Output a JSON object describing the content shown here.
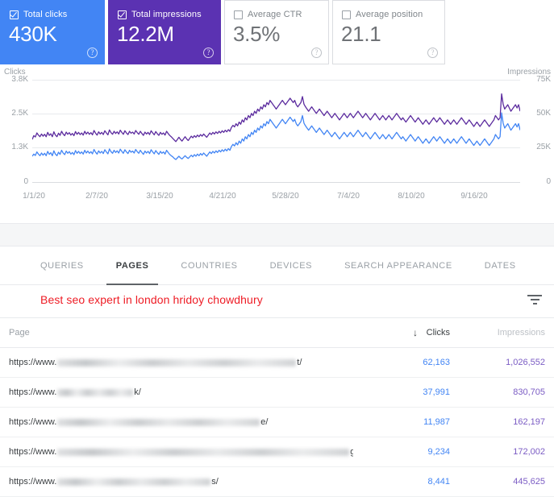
{
  "metric_cards": [
    {
      "label": "Total clicks",
      "value": "430K",
      "checked": true,
      "color": "#4285f4",
      "help": "?"
    },
    {
      "label": "Total impressions",
      "value": "12.2M",
      "checked": true,
      "color": "#5b32b2",
      "help": "?"
    },
    {
      "label": "Average CTR",
      "value": "3.5%",
      "checked": false,
      "color": "#ffffff",
      "help": "?"
    },
    {
      "label": "Average position",
      "value": "21.1",
      "checked": false,
      "color": "#ffffff",
      "help": "?"
    }
  ],
  "chart_data": {
    "type": "line",
    "title": "",
    "left_axis_label": "Clicks",
    "right_axis_label": "Impressions",
    "left_ticks": [
      "3.8K",
      "2.5K",
      "1.3K",
      "0"
    ],
    "right_ticks": [
      "75K",
      "50K",
      "25K",
      "0"
    ],
    "left_ylim": [
      0,
      3800
    ],
    "right_ylim": [
      0,
      75000
    ],
    "grid": true,
    "legend_position": "none",
    "x_tick_labels": [
      "1/1/20",
      "2/7/20",
      "3/15/20",
      "4/21/20",
      "5/28/20",
      "7/4/20",
      "8/10/20",
      "9/16/20"
    ],
    "series": [
      {
        "name": "Total impressions",
        "color": "#5b2b9e",
        "axis": "right",
        "values": [
          1600,
          1740,
          1690,
          1840,
          1760,
          1700,
          1800,
          1720,
          1790,
          1700,
          1860,
          1750,
          1810,
          1700,
          1880,
          1760,
          1700,
          1830,
          1750,
          1900,
          1800,
          1740,
          1870,
          1790,
          1850,
          1760,
          1820,
          1740,
          1890,
          1790,
          1860,
          1780,
          1840,
          1760,
          1900,
          1800,
          1870,
          1790,
          1850,
          1770,
          1930,
          1830,
          1760,
          1880,
          1800,
          1860,
          1780,
          1920,
          1840,
          1770,
          1950,
          1850,
          1790,
          1900,
          1820,
          1880,
          1800,
          1940,
          1860,
          1790,
          1920,
          1840,
          1780,
          1900,
          1830,
          1870,
          1800,
          1930,
          1850,
          1790,
          1900,
          1820,
          1750,
          1870,
          1800,
          1860,
          1780,
          1920,
          1840,
          1770,
          1890,
          1810,
          1750,
          1860,
          1790,
          1840,
          1760,
          1900,
          1820,
          1750,
          1700,
          1640,
          1580,
          1520,
          1600,
          1680,
          1600,
          1540,
          1620,
          1700,
          1620,
          1560,
          1640,
          1720,
          1660,
          1740,
          1680,
          1760,
          1700,
          1780,
          1720,
          1800,
          1740,
          1680,
          1760,
          1840,
          1780,
          1860,
          1800,
          1880,
          1820,
          1900,
          1840,
          1920,
          1860,
          1940,
          1880,
          1960,
          1900,
          2040,
          2120,
          2060,
          2180,
          2100,
          2240,
          2160,
          2320,
          2240,
          2400,
          2320,
          2480,
          2400,
          2560,
          2480,
          2640,
          2560,
          2720,
          2640,
          2800,
          2720,
          2880,
          2800,
          2960,
          2880,
          3040,
          2960,
          2880,
          2800,
          2720,
          2800,
          2880,
          2960,
          3040,
          2960,
          2880,
          2960,
          3040,
          3120,
          3040,
          2960,
          3040,
          2880,
          2800,
          2880,
          2960,
          3180,
          2900,
          2800,
          2720,
          2640,
          2720,
          2800,
          2720,
          2640,
          2560,
          2640,
          2720,
          2640,
          2560,
          2480,
          2560,
          2640,
          2560,
          2480,
          2400,
          2480,
          2560,
          2480,
          2400,
          2320,
          2400,
          2480,
          2560,
          2480,
          2400,
          2480,
          2560,
          2480,
          2400,
          2480,
          2560,
          2640,
          2560,
          2480,
          2400,
          2480,
          2560,
          2480,
          2400,
          2320,
          2400,
          2480,
          2560,
          2480,
          2400,
          2320,
          2400,
          2480,
          2400,
          2320,
          2400,
          2480,
          2400,
          2320,
          2400,
          2480,
          2560,
          2480,
          2400,
          2320,
          2400,
          2320,
          2240,
          2320,
          2400,
          2480,
          2400,
          2320,
          2240,
          2320,
          2400,
          2320,
          2240,
          2160,
          2240,
          2320,
          2240,
          2160,
          2240,
          2320,
          2400,
          2320,
          2240,
          2320,
          2400,
          2320,
          2240,
          2160,
          2240,
          2320,
          2240,
          2160,
          2240,
          2320,
          2240,
          2160,
          2240,
          2320,
          2400,
          2320,
          2240,
          2160,
          2240,
          2320,
          2240,
          2160,
          2080,
          2160,
          2240,
          2160,
          2080,
          2160,
          2240,
          2320,
          2240,
          2160,
          2080,
          2160,
          2240,
          2320,
          2480,
          2400,
          2320,
          2400,
          3280,
          2900,
          2720,
          2800,
          2880,
          2760,
          2640,
          2720,
          2800,
          2880,
          2760,
          2880,
          2640
        ]
      },
      {
        "name": "Total clicks",
        "color": "#4285f4",
        "axis": "left",
        "values": [
          980,
          1060,
          1010,
          1140,
          1060,
          1000,
          1100,
          1020,
          1090,
          1000,
          1160,
          1050,
          1110,
          1000,
          1180,
          1060,
          1000,
          1130,
          1050,
          1200,
          1100,
          1040,
          1170,
          1090,
          1150,
          1060,
          1120,
          1040,
          1190,
          1090,
          1160,
          1080,
          1140,
          1060,
          1200,
          1100,
          1170,
          1090,
          1150,
          1070,
          1230,
          1130,
          1060,
          1180,
          1100,
          1160,
          1080,
          1220,
          1140,
          1070,
          1250,
          1150,
          1090,
          1200,
          1120,
          1180,
          1100,
          1240,
          1160,
          1090,
          1220,
          1140,
          1080,
          1200,
          1130,
          1170,
          1100,
          1230,
          1150,
          1090,
          1200,
          1120,
          1050,
          1170,
          1100,
          1160,
          1080,
          1220,
          1140,
          1070,
          1190,
          1110,
          1050,
          1160,
          1090,
          1140,
          1060,
          1200,
          1120,
          1050,
          1000,
          960,
          900,
          860,
          920,
          980,
          920,
          880,
          940,
          1000,
          940,
          900,
          960,
          1020,
          960,
          1040,
          980,
          1060,
          1000,
          1080,
          1020,
          1100,
          1040,
          980,
          1060,
          1140,
          1080,
          1160,
          1100,
          1180,
          1120,
          1200,
          1140,
          1220,
          1160,
          1240,
          1180,
          1260,
          1200,
          1340,
          1420,
          1360,
          1480,
          1400,
          1540,
          1460,
          1620,
          1540,
          1700,
          1620,
          1780,
          1700,
          1860,
          1780,
          1940,
          1860,
          2020,
          1940,
          2100,
          2020,
          2180,
          2100,
          2260,
          2180,
          2340,
          2260,
          2180,
          2100,
          2020,
          2100,
          2180,
          2260,
          2340,
          2260,
          2180,
          2260,
          2340,
          2420,
          2340,
          2260,
          2340,
          2180,
          2100,
          2180,
          2260,
          2480,
          2200,
          2100,
          2020,
          1940,
          2020,
          2100,
          2020,
          1940,
          1860,
          1940,
          2020,
          1940,
          1860,
          1780,
          1860,
          1940,
          1860,
          1780,
          1700,
          1780,
          1860,
          1780,
          1700,
          1620,
          1700,
          1780,
          1860,
          1780,
          1700,
          1780,
          1860,
          1780,
          1700,
          1780,
          1860,
          1940,
          1860,
          1780,
          1700,
          1780,
          1860,
          1780,
          1700,
          1620,
          1700,
          1780,
          1860,
          1780,
          1700,
          1620,
          1700,
          1780,
          1700,
          1620,
          1700,
          1780,
          1700,
          1620,
          1700,
          1780,
          1860,
          1780,
          1700,
          1620,
          1700,
          1620,
          1540,
          1620,
          1700,
          1780,
          1700,
          1620,
          1540,
          1620,
          1700,
          1620,
          1540,
          1460,
          1540,
          1620,
          1540,
          1460,
          1540,
          1620,
          1700,
          1620,
          1540,
          1620,
          1700,
          1620,
          1540,
          1460,
          1540,
          1620,
          1540,
          1460,
          1540,
          1620,
          1540,
          1460,
          1540,
          1620,
          1700,
          1620,
          1540,
          1460,
          1540,
          1620,
          1540,
          1460,
          1380,
          1460,
          1540,
          1460,
          1380,
          1460,
          1540,
          1620,
          1540,
          1460,
          1380,
          1460,
          1540,
          1620,
          1780,
          1700,
          1620,
          1700,
          2580,
          2200,
          2020,
          2100,
          2180,
          2060,
          1940,
          2020,
          2100,
          2180,
          2060,
          2180,
          1940
        ]
      }
    ]
  },
  "tabs": [
    {
      "label": "QUERIES",
      "active": false
    },
    {
      "label": "PAGES",
      "active": true
    },
    {
      "label": "COUNTRIES",
      "active": false
    },
    {
      "label": "DEVICES",
      "active": false
    },
    {
      "label": "SEARCH APPEARANCE",
      "active": false
    },
    {
      "label": "DATES",
      "active": false
    }
  ],
  "annotation": {
    "text": "Best seo expert in london hridoy chowdhury",
    "color": "#ee1c25"
  },
  "table": {
    "headers": {
      "page": "Page",
      "clicks": "Clicks",
      "impressions": "Impressions",
      "sort_arrow": "↓"
    },
    "rows": [
      {
        "url_prefix": "https://www.",
        "url_suffix": "t/",
        "blur_width": 296,
        "clicks": "62,163",
        "impressions": "1,026,552"
      },
      {
        "url_prefix": "https://www.",
        "url_suffix": "k/",
        "blur_width": 94,
        "clicks": "37,991",
        "impressions": "830,705"
      },
      {
        "url_prefix": "https://www.",
        "url_suffix": "e/",
        "blur_width": 251,
        "clicks": "11,987",
        "impressions": "162,197"
      },
      {
        "url_prefix": "https://www.",
        "url_suffix": "g/",
        "blur_width": 362,
        "clicks": "9,234",
        "impressions": "172,002"
      },
      {
        "url_prefix": "https://www.",
        "url_suffix": "s/",
        "blur_width": 190,
        "clicks": "8,441",
        "impressions": "445,625"
      }
    ]
  }
}
